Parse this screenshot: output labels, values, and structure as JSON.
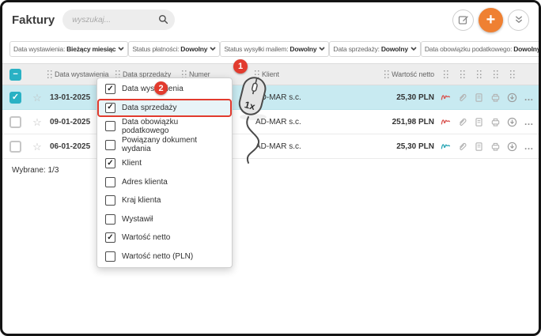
{
  "header": {
    "title": "Faktury",
    "search_placeholder": "wyszukaj...",
    "add_label": "+"
  },
  "filters": [
    {
      "label": "Data wystawienia:",
      "value": "Bieżący miesiąc"
    },
    {
      "label": "Status płatności:",
      "value": "Dowolny"
    },
    {
      "label": "Status wysyłki mailem:",
      "value": "Dowolny"
    },
    {
      "label": "Data sprzedaży:",
      "value": "Dowolny"
    },
    {
      "label": "Data obowiązku podatkowego:",
      "value": "Dowolny"
    }
  ],
  "table": {
    "columns": {
      "issue_date": "Data wystawienia",
      "sale_date": "Data sprzedaży",
      "number": "Numer",
      "client": "Klient",
      "net_value": "Wartość netto"
    },
    "header_check": "−",
    "rows": [
      {
        "issue_date": "13-01-2025",
        "client": "AD-MAR s.c.",
        "net_value": "25,30 PLN",
        "selected": true,
        "check": "✓",
        "flag_color": "#d9534f"
      },
      {
        "issue_date": "09-01-2025",
        "client": "AD-MAR s.c.",
        "net_value": "251,98 PLN",
        "selected": false,
        "check": "",
        "flag_color": "#d9534f"
      },
      {
        "issue_date": "06-01-2025",
        "client": "AD-MAR s.c.",
        "net_value": "25,30 PLN",
        "selected": false,
        "check": "",
        "flag_color": "#2aa6b5"
      }
    ],
    "selected_summary": "Wybrane: 1/3"
  },
  "column_menu": {
    "items": [
      {
        "label": "Data wystawienia",
        "checked": true,
        "check": "✓"
      },
      {
        "label": "Data sprzedaży",
        "checked": true,
        "check": "✓",
        "highlighted": true
      },
      {
        "label": "Data obowiązku podatkowego",
        "checked": false,
        "check": ""
      },
      {
        "label": "Powiązany dokument wydania",
        "checked": false,
        "check": ""
      },
      {
        "label": "Klient",
        "checked": true,
        "check": "✓"
      },
      {
        "label": "Adres klienta",
        "checked": false,
        "check": ""
      },
      {
        "label": "Kraj klienta",
        "checked": false,
        "check": ""
      },
      {
        "label": "Wystawił",
        "checked": false,
        "check": ""
      },
      {
        "label": "Wartość netto",
        "checked": true,
        "check": "✓"
      },
      {
        "label": "Wartość netto (PLN)",
        "checked": false,
        "check": ""
      }
    ]
  },
  "annotations": {
    "step1": "1",
    "step2": "2",
    "mouse_clicks": "1x"
  },
  "icons": {
    "star": "☆",
    "more": "…"
  },
  "colors": {
    "accent_teal": "#2ab1c4",
    "selected_row_bg": "#c8eaf1",
    "add_button_orange": "#ef8032",
    "annotation_red": "#e23b2e",
    "signature_red": "#d9534f",
    "signature_teal": "#2aa6b5"
  }
}
